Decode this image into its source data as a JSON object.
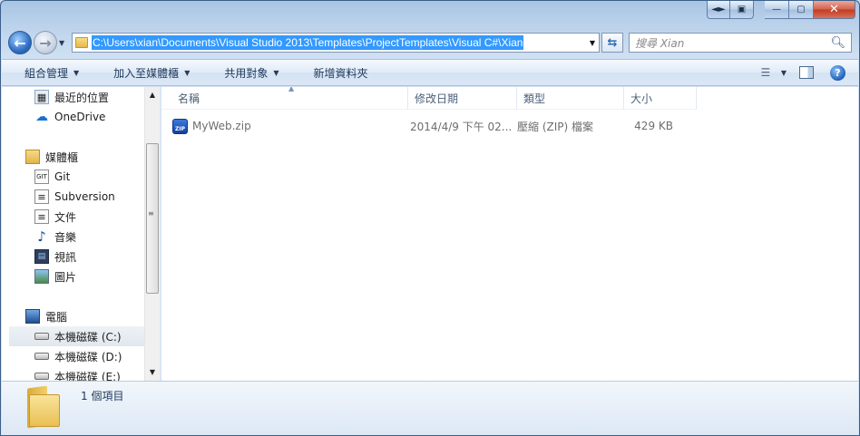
{
  "window": {
    "caption_buttons": [
      "◄►",
      "▣",
      "—",
      "▢",
      "✕"
    ]
  },
  "navbar": {
    "address": "C:\\Users\\xian\\Documents\\Visual Studio 2013\\Templates\\ProjectTemplates\\Visual C#\\Xian",
    "search_placeholder": "搜尋 Xian"
  },
  "commands": [
    "組合管理",
    "加入至媒體櫃",
    "共用對象",
    "新增資料夾"
  ],
  "sidebar": {
    "items": [
      {
        "label": "最近的位置",
        "icon": "recent-places-icon"
      },
      {
        "label": "OneDrive",
        "icon": "cloud-icon"
      },
      {
        "label": "媒體櫃",
        "icon": "libraries-icon"
      },
      {
        "label": "Git",
        "icon": "git-icon"
      },
      {
        "label": "Subversion",
        "icon": "document-icon"
      },
      {
        "label": "文件",
        "icon": "document-icon"
      },
      {
        "label": "音樂",
        "icon": "music-icon"
      },
      {
        "label": "視訊",
        "icon": "video-icon"
      },
      {
        "label": "圖片",
        "icon": "pictures-icon"
      },
      {
        "label": "電腦",
        "icon": "computer-icon"
      },
      {
        "label": "本機磁碟 (C:)",
        "icon": "drive-icon"
      },
      {
        "label": "本機磁碟 (D:)",
        "icon": "drive-icon"
      },
      {
        "label": "本機磁碟 (E:)",
        "icon": "drive-icon"
      }
    ]
  },
  "columns": [
    "名稱",
    "修改日期",
    "類型",
    "大小"
  ],
  "files": [
    {
      "name": "MyWeb.zip",
      "modified": "2014/4/9 下午 02...",
      "type": "壓縮 (ZIP) 檔案",
      "size": "429 KB",
      "icon": "zip-icon"
    }
  ],
  "status": {
    "count_text": "1 個項目"
  }
}
